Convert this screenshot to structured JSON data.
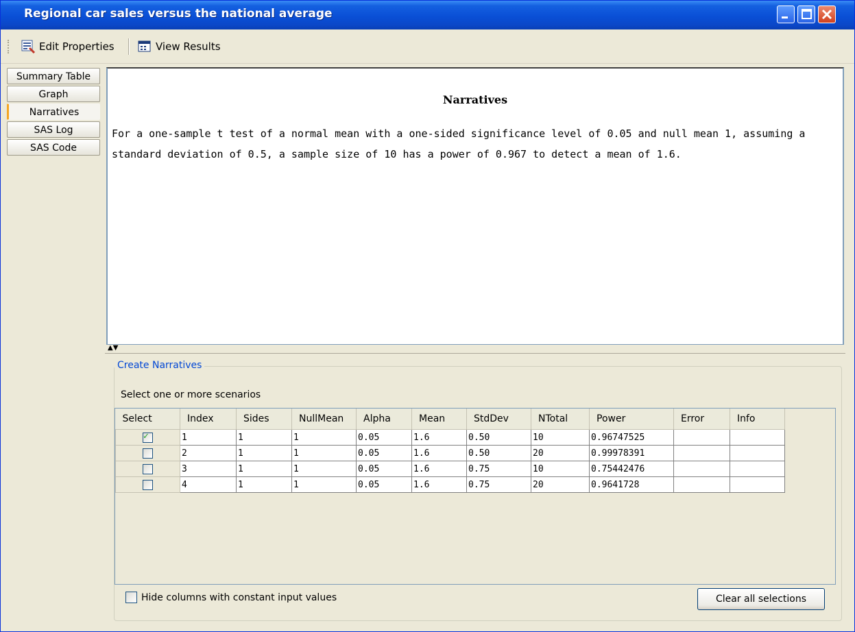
{
  "window": {
    "title": "Regional car sales versus the national average"
  },
  "toolbar": {
    "edit_label": "Edit Properties",
    "view_label": "View Results"
  },
  "tabs": [
    {
      "label": "Summary Table",
      "active": false
    },
    {
      "label": "Graph",
      "active": false
    },
    {
      "label": "Narratives",
      "active": true
    },
    {
      "label": "SAS Log",
      "active": false
    },
    {
      "label": "SAS Code",
      "active": false
    }
  ],
  "narratives": {
    "heading": "Narratives",
    "text": "For a one-sample t test of a normal mean with a one-sided significance level of 0.05 and null mean 1, assuming a standard deviation of 0.5, a sample size of 10 has a power of 0.967 to detect a mean of 1.6."
  },
  "create": {
    "legend": "Create Narratives",
    "select_label": "Select one or more scenarios",
    "columns": [
      "Select",
      "Index",
      "Sides",
      "NullMean",
      "Alpha",
      "Mean",
      "StdDev",
      "NTotal",
      "Power",
      "Error",
      "Info"
    ],
    "rows": [
      {
        "selected": true,
        "cells": [
          "1",
          "1",
          "1",
          "0.05",
          "1.6",
          "0.50",
          "10",
          "0.96747525",
          "",
          ""
        ]
      },
      {
        "selected": false,
        "cells": [
          "2",
          "1",
          "1",
          "0.05",
          "1.6",
          "0.50",
          "20",
          "0.99978391",
          "",
          ""
        ]
      },
      {
        "selected": false,
        "cells": [
          "3",
          "1",
          "1",
          "0.05",
          "1.6",
          "0.75",
          "10",
          "0.75442476",
          "",
          ""
        ]
      },
      {
        "selected": false,
        "cells": [
          "4",
          "1",
          "1",
          "0.05",
          "1.6",
          "0.75",
          "20",
          "0.9641728",
          "",
          ""
        ]
      }
    ],
    "hide_label": "Hide columns with constant input values",
    "hide_checked": false,
    "clear_label": "Clear all selections"
  },
  "colors": {
    "title_bar": "#0a4fd6",
    "legend_text": "#0046d5",
    "active_tab_accent": "#f5a623"
  }
}
